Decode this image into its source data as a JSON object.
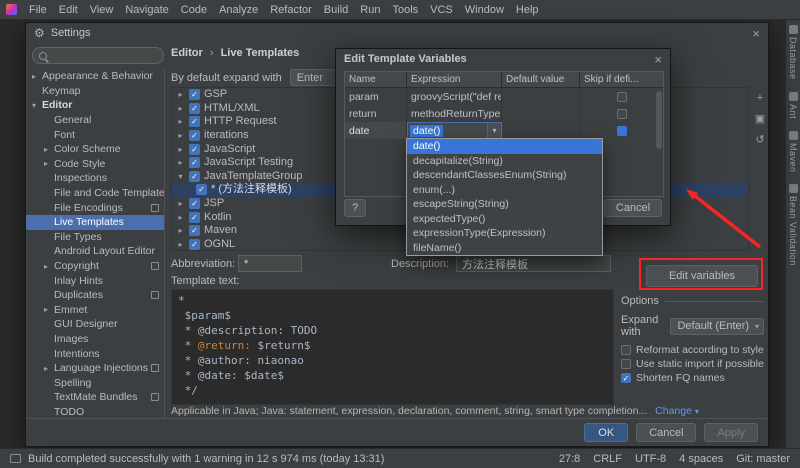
{
  "icons": {
    "gear": "⚙",
    "close": "×",
    "chevron_down": "▾",
    "arrow_right": "▸",
    "check": "✓",
    "add": "+",
    "duplicate": "▣",
    "restore": "↺"
  },
  "menu_bar": {
    "items": [
      "File",
      "Edit",
      "View",
      "Navigate",
      "Code",
      "Analyze",
      "Refactor",
      "Build",
      "Run",
      "Tools",
      "VCS",
      "Window",
      "Help"
    ]
  },
  "right_stripe": {
    "items": [
      "Database",
      "Ant",
      "Maven",
      "Bean Validation"
    ]
  },
  "settings": {
    "title": "Settings",
    "breadcrumb": {
      "part1": "Editor",
      "sep": "›",
      "part2": "Live Templates"
    },
    "expand_default_label": "By default expand with",
    "expand_default_value": "Enter",
    "sidebar_items": [
      {
        "label": "Appearance & Behavior",
        "top": true,
        "arrow": "right"
      },
      {
        "label": "Keymap",
        "top": true
      },
      {
        "label": "Editor",
        "top": true,
        "arrow": "down",
        "bold": true
      },
      {
        "label": "General"
      },
      {
        "label": "Font"
      },
      {
        "label": "Color Scheme",
        "arrow": "right"
      },
      {
        "label": "Code Style",
        "arrow": "right"
      },
      {
        "label": "Inspections"
      },
      {
        "label": "File and Code Templates",
        "badge": true
      },
      {
        "label": "File Encodings",
        "badge": true
      },
      {
        "label": "Live Templates",
        "selected": true
      },
      {
        "label": "File Types"
      },
      {
        "label": "Android Layout Editor"
      },
      {
        "label": "Copyright",
        "arrow": "right",
        "badge": true
      },
      {
        "label": "Inlay Hints"
      },
      {
        "label": "Duplicates",
        "badge": true
      },
      {
        "label": "Emmet",
        "arrow": "right"
      },
      {
        "label": "GUI Designer"
      },
      {
        "label": "Images"
      },
      {
        "label": "Intentions"
      },
      {
        "label": "Language Injections",
        "arrow": "right",
        "badge": true
      },
      {
        "label": "Spelling"
      },
      {
        "label": "TextMate Bundles",
        "badge": true
      },
      {
        "label": "TODO"
      }
    ],
    "tree_items": [
      {
        "label": "GSP"
      },
      {
        "label": "HTML/XML"
      },
      {
        "label": "HTTP Request"
      },
      {
        "label": "iterations"
      },
      {
        "label": "JavaScript"
      },
      {
        "label": "JavaScript Testing"
      },
      {
        "label": "JavaTemplateGroup",
        "expanded": true
      },
      {
        "label": "* (方法注释模板)",
        "child": true,
        "selected": true
      },
      {
        "label": "JSP"
      },
      {
        "label": "Kotlin"
      },
      {
        "label": "Maven"
      },
      {
        "label": "OGNL"
      }
    ],
    "tree_toolbar": [
      "add",
      "duplicate",
      "restore"
    ],
    "abbreviation_label": "Abbreviation:",
    "abbreviation_value": "*",
    "description_label": "Description:",
    "description_value": "方法注释模板",
    "template_text_label": "Template text:",
    "template_lines": [
      [
        {
          "t": "*"
        }
      ],
      [
        {
          "t": " $param$"
        }
      ],
      [
        {
          "t": " * @description: TODO"
        }
      ],
      [
        {
          "t": " * "
        },
        {
          "t": "@return:",
          "c": "orange"
        },
        {
          "t": " $return$"
        }
      ],
      [
        {
          "t": " * @author: niaonao"
        }
      ],
      [
        {
          "t": " * @date: $date$"
        }
      ],
      [
        {
          "t": " */"
        }
      ]
    ],
    "edit_variables_button": "Edit variables",
    "options": {
      "title": "Options",
      "expand_with_label": "Expand with",
      "expand_with_value": "Default (Enter)",
      "checkboxes": [
        {
          "label": "Reformat according to style",
          "checked": false
        },
        {
          "label": "Use static import if possible",
          "checked": false
        },
        {
          "label": "Shorten FQ names",
          "checked": true
        }
      ]
    },
    "applicable_text": "Applicable in Java; Java: statement, expression, declaration, comment, string, smart type completion...",
    "change_link": "Change",
    "ok": "OK",
    "cancel": "Cancel",
    "apply": "Apply"
  },
  "vars_dialog": {
    "title": "Edit Template Variables",
    "columns": [
      "Name",
      "Expression",
      "Default value",
      "Skip if defi..."
    ],
    "rows": [
      {
        "name": "param",
        "expression": "groovyScript(\"def result...",
        "default": "",
        "skip": false
      },
      {
        "name": "return",
        "expression": "methodReturnType()",
        "default": "",
        "skip": false
      },
      {
        "name": "date",
        "expression": "date()",
        "default": "",
        "skip": true,
        "editing": true
      }
    ],
    "dropdown_options": [
      "date()",
      "decapitalize(String)",
      "descendantClassesEnum(String)",
      "enum(...)",
      "escapeString(String)",
      "expectedType()",
      "expressionType(Expression)",
      "fileName()"
    ],
    "help": "?",
    "cancel": "Cancel"
  },
  "status_bar": {
    "message": "Build completed successfully with 1 warning in 12 s 974 ms (today 13:31)",
    "right_items": [
      "27:8",
      "CRLF",
      "UTF-8",
      "4 spaces",
      "Git: master"
    ]
  }
}
